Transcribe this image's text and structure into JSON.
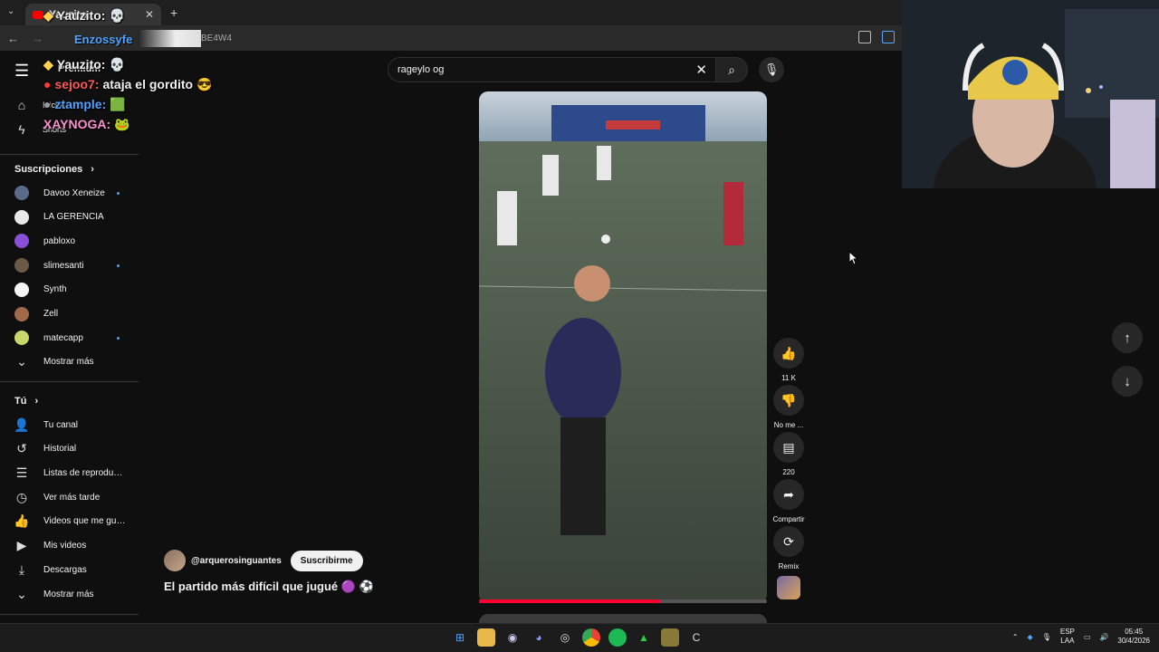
{
  "browser": {
    "tab_label": "Yauzito:",
    "url_tail": "BE4W4"
  },
  "chat": [
    {
      "user": "Yauzito:",
      "message": "",
      "user_color": "#f1f1f1",
      "emote": "💀"
    },
    {
      "user": "sejoo7:",
      "message": "ataja el gordito",
      "user_color": "#ff5a5a",
      "emote": "😎"
    },
    {
      "user": "ztample:",
      "message": "",
      "user_color": "#4fa3ff",
      "emote": "🟩"
    },
    {
      "user": "XAYNOGA:",
      "message": "",
      "user_color": "#ff8fd0",
      "emote": "🐸"
    }
  ],
  "overlay_names": {
    "enzossy": "Enzossyfe",
    "premium": "Premium"
  },
  "sidebar": {
    "home": "Inicio",
    "shorts": "Shorts",
    "subscriptions_title": "Suscripciones",
    "subscriptions": [
      {
        "name": "Davoo Xeneize",
        "color": "#5a6b8a",
        "new": true
      },
      {
        "name": "LA GERENCIA",
        "color": "#e8e8e8",
        "new": false
      },
      {
        "name": "pabloxo",
        "color": "#8a4fd8",
        "new": false
      },
      {
        "name": "slimesanti",
        "color": "#6a5a45",
        "new": true
      },
      {
        "name": "Synth",
        "color": "#f5f5f5",
        "new": false
      },
      {
        "name": "Zell",
        "color": "#a06a4a",
        "new": false
      },
      {
        "name": "matecapp",
        "color": "#c8d66a",
        "new": true
      }
    ],
    "show_more": "Mostrar más",
    "you_title": "Tú",
    "you_items": [
      {
        "label": "Tu canal",
        "icon": "👤",
        "name": "your-channel"
      },
      {
        "label": "Historial",
        "icon": "↺",
        "name": "history"
      },
      {
        "label": "Listas de reproducc...",
        "icon": "☰",
        "name": "playlists"
      },
      {
        "label": "Ver más tarde",
        "icon": "◷",
        "name": "watch-later"
      },
      {
        "label": "Videos que me gus...",
        "icon": "👍",
        "name": "liked-videos"
      },
      {
        "label": "Mis videos",
        "icon": "▶",
        "name": "my-videos"
      },
      {
        "label": "Descargas",
        "icon": "⤓",
        "name": "downloads"
      }
    ],
    "show_more_2": "Mostrar más"
  },
  "search": {
    "value": "rageylo og"
  },
  "short": {
    "progress": 0.63,
    "channel": "@arquerosinguantes",
    "subscribe_label": "Suscribirme",
    "title": "El partido más difícil que jugué 🟣 ⚽"
  },
  "actions": {
    "likes": "11 K",
    "dislike": "No me ...",
    "comments": "220",
    "share": "Compartir",
    "remix": "Remix"
  },
  "taskbar": {
    "lang": "ESP",
    "layout": "LAA",
    "time": "05:45",
    "date": "30/4/2026"
  }
}
